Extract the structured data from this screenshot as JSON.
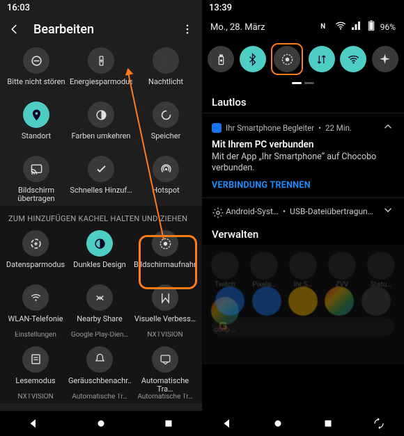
{
  "left": {
    "status_time": "16:03",
    "header_title": "Bearbeiten",
    "tiles_top": [
      {
        "label": "Bitte nicht stören",
        "icon": "dnd-icon"
      },
      {
        "label": "Energiesparmodus",
        "icon": "battery-saver-icon"
      },
      {
        "label": "Nachtlicht",
        "icon": "night-light-icon"
      },
      {
        "label": "Standort",
        "icon": "location-icon",
        "active": true
      },
      {
        "label": "Farben umkehren",
        "icon": "invert-colors-icon"
      },
      {
        "label": "Speicher",
        "icon": "storage-icon"
      },
      {
        "label": "Bildschirm übertragen",
        "icon": "cast-icon"
      },
      {
        "label": "Schnelles Hinzuf…",
        "icon": "check-icon"
      },
      {
        "label": "Hotspot",
        "icon": "hotspot-icon"
      }
    ],
    "section_hint": "ZUM HINZUFÜGEN KACHEL HALTEN UND ZIEHEN",
    "tiles_bottom": [
      {
        "label": "Datensparmodus",
        "sub": "",
        "icon": "data-saver-icon"
      },
      {
        "label": "Dunkles Design",
        "sub": "",
        "icon": "dark-mode-icon",
        "active": true
      },
      {
        "label": "Bildschirmaufnahme",
        "sub": "",
        "icon": "screen-record-icon"
      },
      {
        "label": "WLAN-Telefonie",
        "sub": "Einstellungen",
        "icon": "wifi-calling-icon"
      },
      {
        "label": "Nearby Share",
        "sub": "Google Play-Dien…",
        "icon": "nearby-share-icon"
      },
      {
        "label": "Visuelle Verbess…",
        "sub": "NXTVISION",
        "icon": "nxtvision-icon"
      },
      {
        "label": "Lesemodus",
        "sub": "NXTVISION",
        "icon": "read-mode-icon"
      },
      {
        "label": "Geräuschbenachr…",
        "sub": "Automatische Tr…",
        "icon": "sound-notif-icon"
      },
      {
        "label": "Automatische Tra…",
        "sub": "Automatische Tr…",
        "icon": "auto-transcribe-icon"
      }
    ]
  },
  "right": {
    "status_time": "13:39",
    "date": "Mo., 28. März",
    "battery_text": "96%",
    "qs": [
      {
        "name": "flashlight",
        "active": false
      },
      {
        "name": "bluetooth",
        "active": true
      },
      {
        "name": "screen-record",
        "active": false,
        "highlight": true
      },
      {
        "name": "data",
        "active": true
      },
      {
        "name": "wifi",
        "active": true
      },
      {
        "name": "airplane",
        "active": false
      }
    ],
    "silent_title": "Lautlos",
    "notif1": {
      "app": "Ihr Smartphone Begleiter",
      "time": "22 Min.",
      "title": "Mit Ihrem PC verbunden",
      "body": "Mit der App „Ihr Smartphone“ auf Chocobo verbunden.",
      "action": "VERBINDUNG TRENNEN"
    },
    "notif2": {
      "app": "Android-Syst…",
      "text": "USB-Dateiübertragung aktiviert"
    },
    "manage_title": "Verwalten",
    "apps_row": [
      "Twitch",
      "Pixela…",
      "Ihr S…",
      "ZVV",
      "Statu…"
    ],
    "apps_row2_first": "coop …"
  }
}
